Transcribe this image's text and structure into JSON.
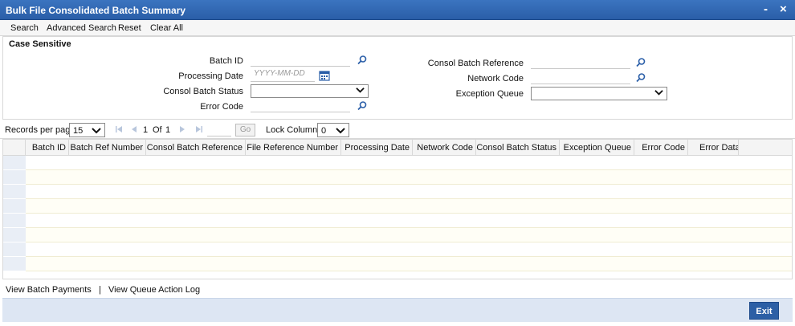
{
  "window": {
    "title": "Bulk File Consolidated Batch Summary",
    "minimize": "-",
    "close": "×"
  },
  "toolbar": {
    "search": "Search",
    "advanced_search": "Advanced Search",
    "reset": "Reset",
    "clear_all": "Clear All"
  },
  "criteria": {
    "case_sensitive": "Case Sensitive",
    "batch_id_label": "Batch ID",
    "processing_date_label": "Processing Date",
    "processing_date_placeholder": "YYYY-MM-DD",
    "consol_batch_status_label": "Consol Batch Status",
    "error_code_label": "Error Code",
    "consol_batch_reference_label": "Consol Batch Reference",
    "network_code_label": "Network Code",
    "exception_queue_label": "Exception Queue"
  },
  "pager": {
    "records_per_page_label": "Records per page",
    "records_per_page_value": "15",
    "current_page": "1",
    "of_label": "Of",
    "total_pages": "1",
    "go_label": "Go",
    "lock_columns_label": "Lock Columns",
    "lock_columns_value": "0"
  },
  "grid": {
    "columns": [
      "Batch ID",
      "Batch Ref Number",
      "Consol Batch Reference",
      "File Reference Number",
      "Processing Date",
      "Network Code",
      "Consol Batch Status",
      "Exception Queue",
      "Error Code",
      "Error Data"
    ]
  },
  "links": {
    "view_batch_payments": "View Batch Payments",
    "separator": "|",
    "view_queue_action_log": "View Queue Action Log"
  },
  "footer": {
    "exit_label": "Exit"
  },
  "colors": {
    "titlebar": "#2a5ea8",
    "footer": "#dde6f3",
    "exit_button": "#2c5fa5"
  }
}
